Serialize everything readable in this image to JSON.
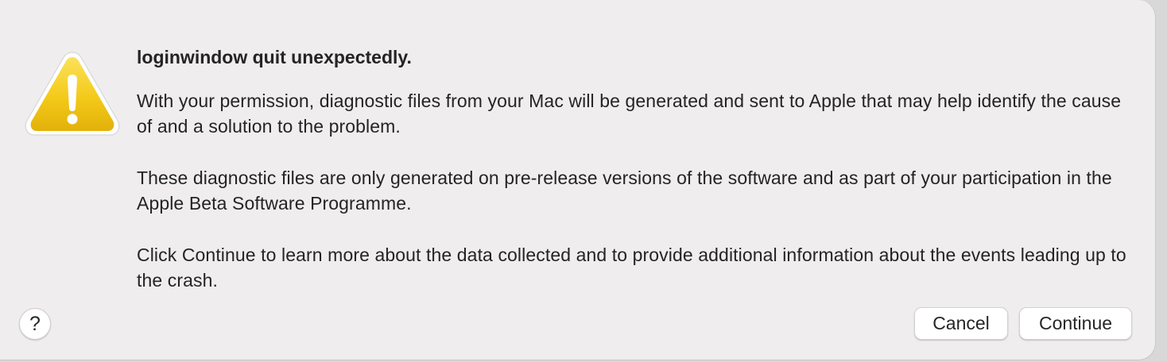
{
  "dialog": {
    "title": "loginwindow quit unexpectedly.",
    "paragraphs": [
      "With your permission, diagnostic files from your Mac will be generated and sent to Apple that may help identify the cause of and a solution to the problem.",
      "These diagnostic files are only generated on pre-release versions of the software and as part of your participation in the Apple Beta Software Programme.",
      "Click Continue to learn more about the data collected and to provide additional information about the events leading up to the crash."
    ],
    "icon": "warning-triangle-icon"
  },
  "buttons": {
    "help_label": "?",
    "cancel_label": "Cancel",
    "continue_label": "Continue"
  },
  "colors": {
    "dialog_background": "#efedee",
    "warning_yellow": "#f2c516",
    "text": "#242424"
  }
}
